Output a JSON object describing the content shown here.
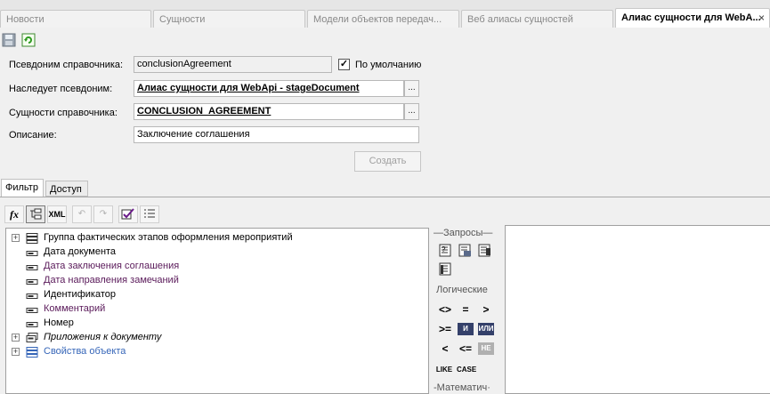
{
  "tabs": [
    {
      "label": "Новости",
      "active": false
    },
    {
      "label": "Сущности",
      "active": false
    },
    {
      "label": "Модели  объектов  передач...",
      "active": false
    },
    {
      "label": "Веб алиасы сущностей",
      "active": false
    },
    {
      "label": "Алиас сущности для WebA...",
      "active": true
    }
  ],
  "toolbar": {
    "save_icon": "save-icon",
    "refresh_icon": "refresh-icon"
  },
  "form": {
    "alias_label": "Псевдоним справочника:",
    "alias_value": "conclusionAgreement",
    "default_label": "По умолчанию",
    "default_checked": "✓",
    "inherits_label": "Наследует псевдоним:",
    "inherits_value": "Алиас сущности для WebApi - stageDocument",
    "entity_label": "Сущности справочника:",
    "entity_value": "CONCLUSION_AGREEMENT",
    "description_label": "Описание:",
    "description_value": "Заключение соглашения",
    "ellipsis": "...",
    "create_button": "Создать"
  },
  "inner_tabs": [
    {
      "label": "Фильтр",
      "active": true
    },
    {
      "label": "Доступ",
      "active": false
    }
  ],
  "filter_toolbar": {
    "fx": "fx",
    "xml": "XML"
  },
  "tree": [
    {
      "label": "Группа фактических этапов оформления мероприятий",
      "color": "black",
      "expandable": true,
      "italic": false,
      "icon": "group-icon"
    },
    {
      "label": "Дата документа",
      "color": "black",
      "expandable": false,
      "italic": false,
      "icon": "field-icon"
    },
    {
      "label": "Дата заключения соглашения",
      "color": "purple",
      "expandable": false,
      "italic": false,
      "icon": "field-icon"
    },
    {
      "label": "Дата направления замечаний",
      "color": "purple",
      "expandable": false,
      "italic": false,
      "icon": "field-icon"
    },
    {
      "label": "Идентификатор",
      "color": "black",
      "expandable": false,
      "italic": false,
      "icon": "field-icon"
    },
    {
      "label": "Комментарий",
      "color": "purple",
      "expandable": false,
      "italic": false,
      "icon": "field-icon"
    },
    {
      "label": "Номер",
      "color": "black",
      "expandable": false,
      "italic": false,
      "icon": "field-icon"
    },
    {
      "label": "Приложения к документу",
      "color": "black",
      "expandable": true,
      "italic": true,
      "icon": "collection-icon"
    },
    {
      "label": "Свойства объекта",
      "color": "blue",
      "expandable": true,
      "italic": false,
      "icon": "properties-icon"
    }
  ],
  "queries": {
    "header": "Запросы",
    "logic_header": "Логические",
    "math_header": "Математич",
    "ops": {
      "not_equal": "<>",
      "equal": "=",
      "greater": ">",
      "greater_equal": ">=",
      "and": "И",
      "or": "ИЛИ",
      "less": "<",
      "less_equal": "<=",
      "not": "НЕ",
      "like": "LIKE",
      "case": "CASE"
    }
  }
}
